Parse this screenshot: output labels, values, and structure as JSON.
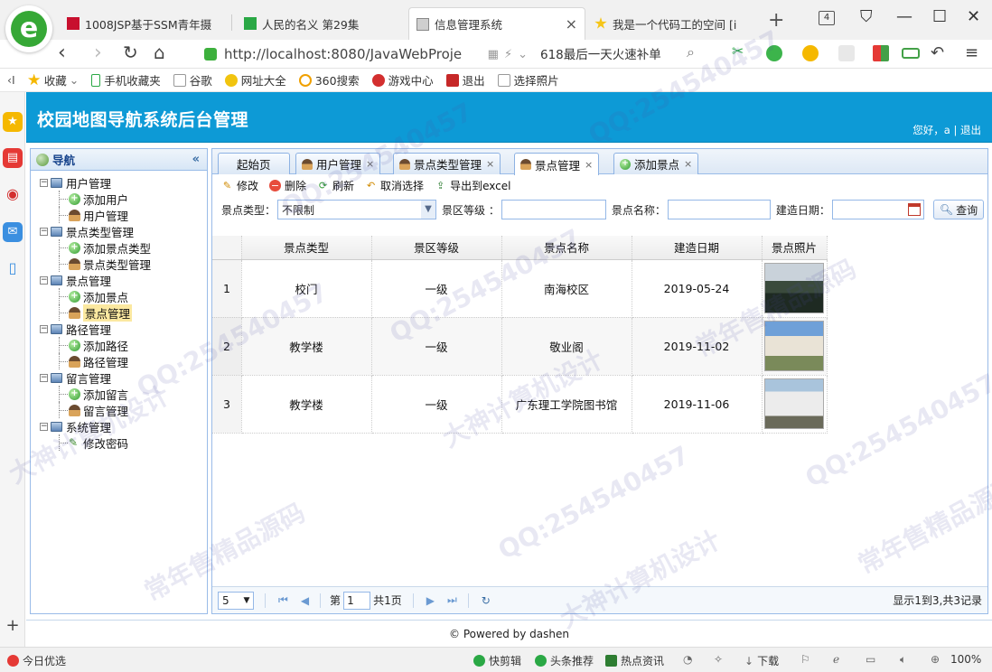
{
  "browser": {
    "tabs": [
      {
        "title": "1008JSP基于SSM青年摄",
        "favicon_color": "#c8102e"
      },
      {
        "title": "人民的名义 第29集",
        "favicon_color": "#2aa845"
      },
      {
        "title": "信息管理系统",
        "favicon_color": "#888888"
      },
      {
        "title": "我是一个代码工的空间 [i",
        "favicon_color": "#f5c518"
      }
    ],
    "tab_count": "4",
    "new_tab": "+",
    "url": "http://localhost:8080/JavaWebProje",
    "search_ad": "618最后一天火速补单",
    "bookmarks": [
      {
        "label": "收藏",
        "icon": "star-icon"
      },
      {
        "label": "手机收藏夹",
        "icon": "phone-icon"
      },
      {
        "label": "谷歌",
        "icon": "page-icon"
      },
      {
        "label": "网址大全",
        "icon": "sites-icon"
      },
      {
        "label": "360搜索",
        "icon": "search-360-icon"
      },
      {
        "label": "游戏中心",
        "icon": "game-icon"
      },
      {
        "label": "退出",
        "icon": "exit-icon"
      },
      {
        "label": "选择照片",
        "icon": "page-icon"
      }
    ]
  },
  "app": {
    "title": "校园地图导航系统后台管理",
    "greeting": "您好，a",
    "separator": " | ",
    "logout": "退出",
    "nav": {
      "title": "导航",
      "collapse_icon": "«",
      "groups": [
        {
          "label": "用户管理",
          "children": [
            {
              "label": "添加用户",
              "type": "add"
            },
            {
              "label": "用户管理",
              "type": "user"
            }
          ]
        },
        {
          "label": "景点类型管理",
          "children": [
            {
              "label": "添加景点类型",
              "type": "add"
            },
            {
              "label": "景点类型管理",
              "type": "user"
            }
          ]
        },
        {
          "label": "景点管理",
          "children": [
            {
              "label": "添加景点",
              "type": "add"
            },
            {
              "label": "景点管理",
              "type": "user"
            }
          ]
        },
        {
          "label": "路径管理",
          "children": [
            {
              "label": "添加路径",
              "type": "add"
            },
            {
              "label": "路径管理",
              "type": "user"
            }
          ]
        },
        {
          "label": "留言管理",
          "children": [
            {
              "label": "添加留言",
              "type": "add"
            },
            {
              "label": "留言管理",
              "type": "user"
            }
          ]
        },
        {
          "label": "系统管理",
          "children": [
            {
              "label": "修改密码",
              "type": "pen"
            }
          ]
        }
      ]
    },
    "tabs": [
      {
        "label": "起始页"
      },
      {
        "label": "用户管理"
      },
      {
        "label": "景点类型管理"
      },
      {
        "label": "景点管理"
      },
      {
        "label": "添加景点"
      }
    ],
    "toolbar": {
      "edit": "修改",
      "delete": "删除",
      "refresh": "刷新",
      "unselect": "取消选择",
      "export": "导出到excel"
    },
    "search": {
      "type_label": "景点类型：",
      "type_value": "不限制",
      "level_label": "景区等级 ：",
      "level_value": "",
      "name_label": "景点名称：",
      "name_value": "",
      "date_label": "建造日期：",
      "date_value": "",
      "button": "查询"
    },
    "grid": {
      "columns": [
        "景点类型",
        "景区等级",
        "景点名称",
        "建造日期",
        "景点照片"
      ],
      "rows": [
        {
          "no": "1",
          "type": "校门",
          "level": "一级",
          "name": "南海校区",
          "date": "2019-05-24"
        },
        {
          "no": "2",
          "type": "教学楼",
          "level": "一级",
          "name": "敬业阁",
          "date": "2019-11-02"
        },
        {
          "no": "3",
          "type": "教学楼",
          "level": "一级",
          "name": "广东理工学院图书馆",
          "date": "2019-11-06"
        }
      ]
    },
    "pager": {
      "page_size": "5",
      "page_label": "第",
      "page_value": "1",
      "total_pages": "共1页",
      "summary": "显示1到3,共3记录"
    },
    "footer": "© Powered by dashen"
  },
  "statusbar": {
    "left": "今日优选",
    "items": [
      "快剪辑",
      "头条推荐",
      "热点资讯"
    ],
    "download": "下载",
    "zoom": "100%"
  },
  "watermarks": [
    "QQ:254540457",
    "常年售精品源码",
    "大神计算机设计"
  ]
}
